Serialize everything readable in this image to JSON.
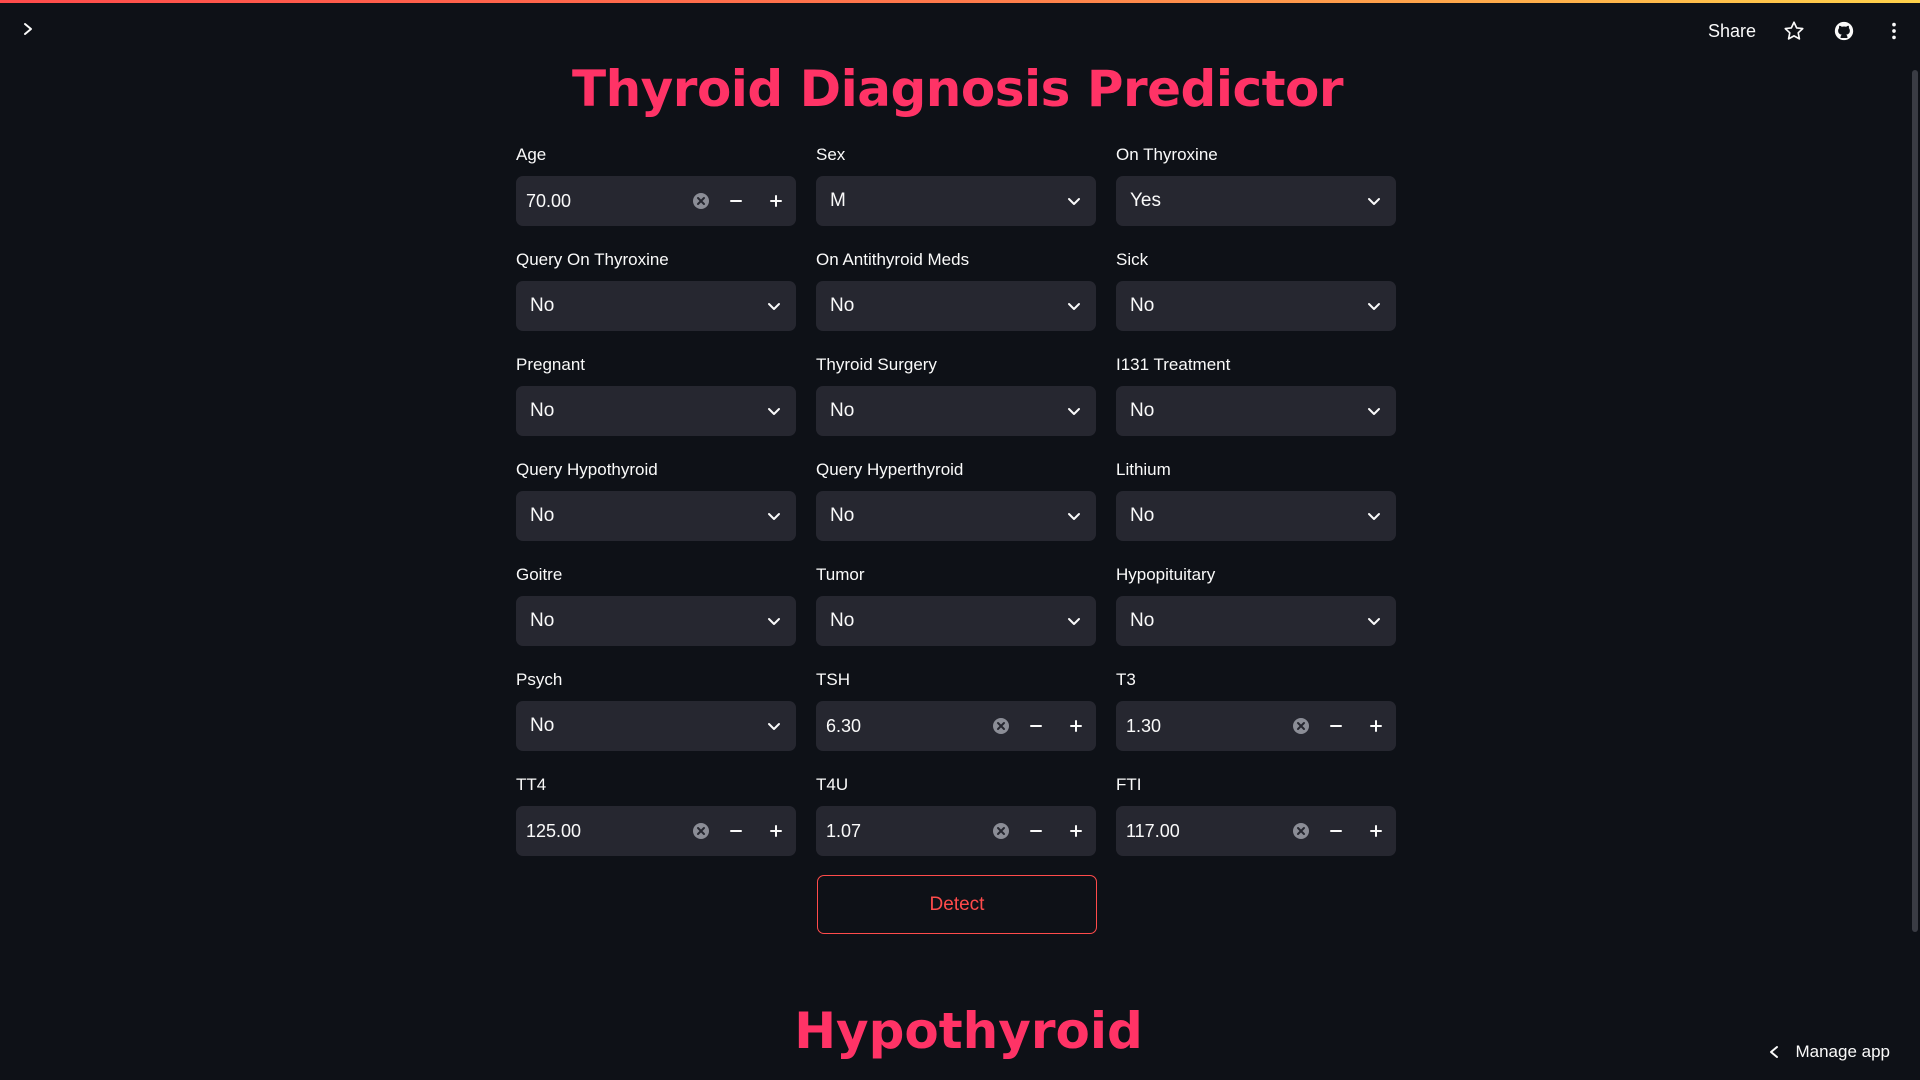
{
  "header": {
    "share_label": "Share",
    "icons": [
      "chevron-right-icon",
      "star-icon",
      "github-icon",
      "more-vertical-icon"
    ]
  },
  "title": "Thyroid Diagnosis Predictor",
  "fields": [
    {
      "label": "Age",
      "type": "number",
      "value": "70.00"
    },
    {
      "label": "Sex",
      "type": "select",
      "value": "M"
    },
    {
      "label": "On Thyroxine",
      "type": "select",
      "value": "Yes"
    },
    {
      "label": "Query On Thyroxine",
      "type": "select",
      "value": "No"
    },
    {
      "label": "On Antithyroid Meds",
      "type": "select",
      "value": "No"
    },
    {
      "label": "Sick",
      "type": "select",
      "value": "No"
    },
    {
      "label": "Pregnant",
      "type": "select",
      "value": "No"
    },
    {
      "label": "Thyroid Surgery",
      "type": "select",
      "value": "No"
    },
    {
      "label": "I131 Treatment",
      "type": "select",
      "value": "No"
    },
    {
      "label": "Query Hypothyroid",
      "type": "select",
      "value": "No"
    },
    {
      "label": "Query Hyperthyroid",
      "type": "select",
      "value": "No"
    },
    {
      "label": "Lithium",
      "type": "select",
      "value": "No"
    },
    {
      "label": "Goitre",
      "type": "select",
      "value": "No"
    },
    {
      "label": "Tumor",
      "type": "select",
      "value": "No"
    },
    {
      "label": "Hypopituitary",
      "type": "select",
      "value": "No"
    },
    {
      "label": "Psych",
      "type": "select",
      "value": "No"
    },
    {
      "label": "TSH",
      "type": "number",
      "value": "6.30"
    },
    {
      "label": "T3",
      "type": "number",
      "value": "1.30"
    },
    {
      "label": "TT4",
      "type": "number",
      "value": "125.00"
    },
    {
      "label": "T4U",
      "type": "number",
      "value": "1.07"
    },
    {
      "label": "FTI",
      "type": "number",
      "value": "117.00"
    }
  ],
  "detect_label": "Detect",
  "result": "Hypothyroid",
  "footer": {
    "manage_app_label": "Manage app"
  },
  "colors": {
    "background": "#0e1117",
    "input_background": "#262730",
    "title": "#ff3366",
    "button_accent": "#ff4b4b",
    "text": "#fafafa"
  }
}
